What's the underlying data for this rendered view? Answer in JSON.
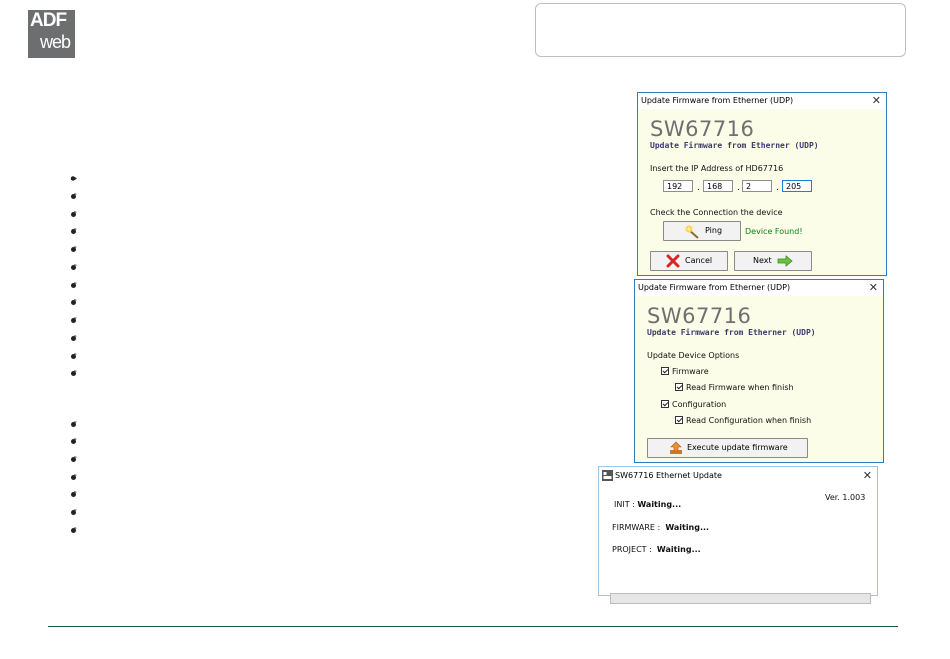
{
  "logo": {
    "line1": "ADF",
    "line2": "web"
  },
  "bullet_count_group1": 12,
  "bullet_count_group2": 7,
  "dialog1": {
    "title": "Update Firmware from Etherner (UDP)",
    "close": "✕",
    "model": "SW67716",
    "subtitle": "Update Firmware from Etherner (UDP)",
    "ip_label": "Insert the IP Address of  HD67716",
    "ip": [
      "192",
      "168",
      "2",
      "205"
    ],
    "ip_sep": ".",
    "check_label": "Check the Connection the device",
    "ping_label": "Ping",
    "status": "Device Found!",
    "cancel_label": "Cancel",
    "next_label": "Next"
  },
  "dialog2": {
    "title": "Update Firmware from Etherner (UDP)",
    "close": "✕",
    "model": "SW67716",
    "subtitle": "Update Firmware from Etherner (UDP)",
    "options_label": "Update Device Options",
    "firmware_label": "Firmware",
    "read_firmware_label": "Read Firmware when finish",
    "configuration_label": "Configuration",
    "read_configuration_label": "Read Configuration when finish",
    "execute_label": "Execute update firmware"
  },
  "dialog3": {
    "title": "SW67716 Ethernet Update",
    "close": "✕",
    "version": "Ver. 1.003",
    "init_label": "INIT : ",
    "init_value": "Waiting...",
    "firmware_label": "FIRMWARE : ",
    "firmware_value": "Waiting...",
    "project_label": "PROJECT : ",
    "project_value": "Waiting...",
    "progress": 0
  },
  "colors": {
    "dialog_border": "#2c7fbf",
    "dialog_body": "#fbfde9",
    "status_green": "#108010",
    "footer_line": "#1e5b4f"
  }
}
